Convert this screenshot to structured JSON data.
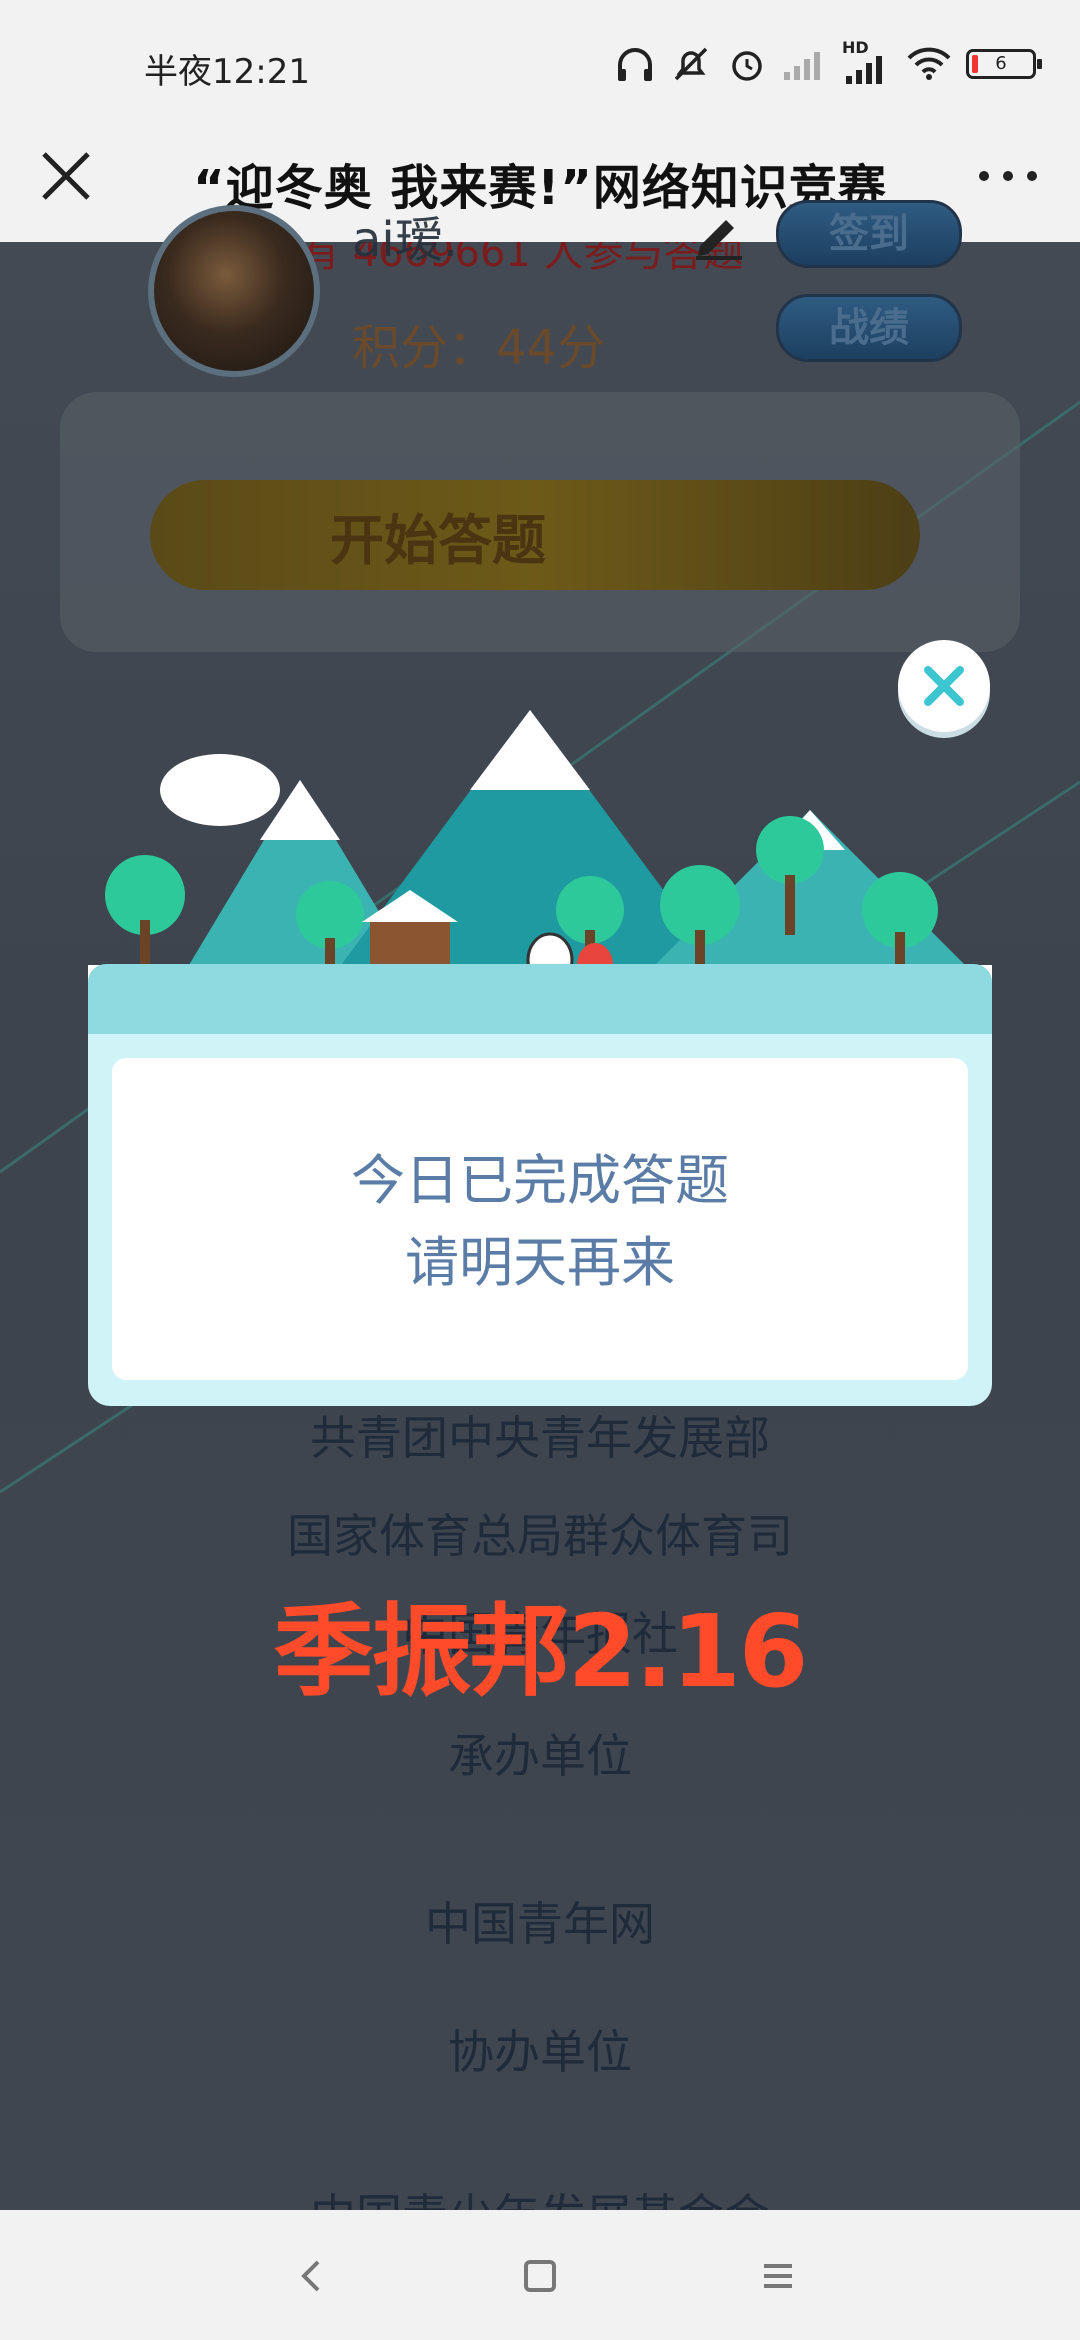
{
  "status_bar": {
    "time": "半夜12:21",
    "battery": "6",
    "network_label": "HD"
  },
  "nav": {
    "title": "“迎冬奥 我来赛!”网络知识竞赛"
  },
  "page": {
    "participants_text": "已有 4669661 人参与答题",
    "user": {
      "name": "ai瑷.",
      "score": "积分：44分"
    },
    "buttons": {
      "signin": "签到",
      "record": "战绩"
    },
    "start_banner": "开始答题",
    "organizers": [
      "共青团中央青年发展部",
      "国家体育总局群众体育司",
      "中国青年报社"
    ],
    "host_heading": "承办单位",
    "host": "中国青年网",
    "co_heading": "协办单位",
    "co": "中国青少年发展基金会"
  },
  "dialog": {
    "line1": "今日已完成答题",
    "line2": "请明天再来"
  },
  "watermark": "季振邦2.16",
  "colors": {
    "accent_dialog": "#8fd9e0",
    "dialog_text": "#5a7ca6",
    "watermark": "#ff4b2a"
  }
}
